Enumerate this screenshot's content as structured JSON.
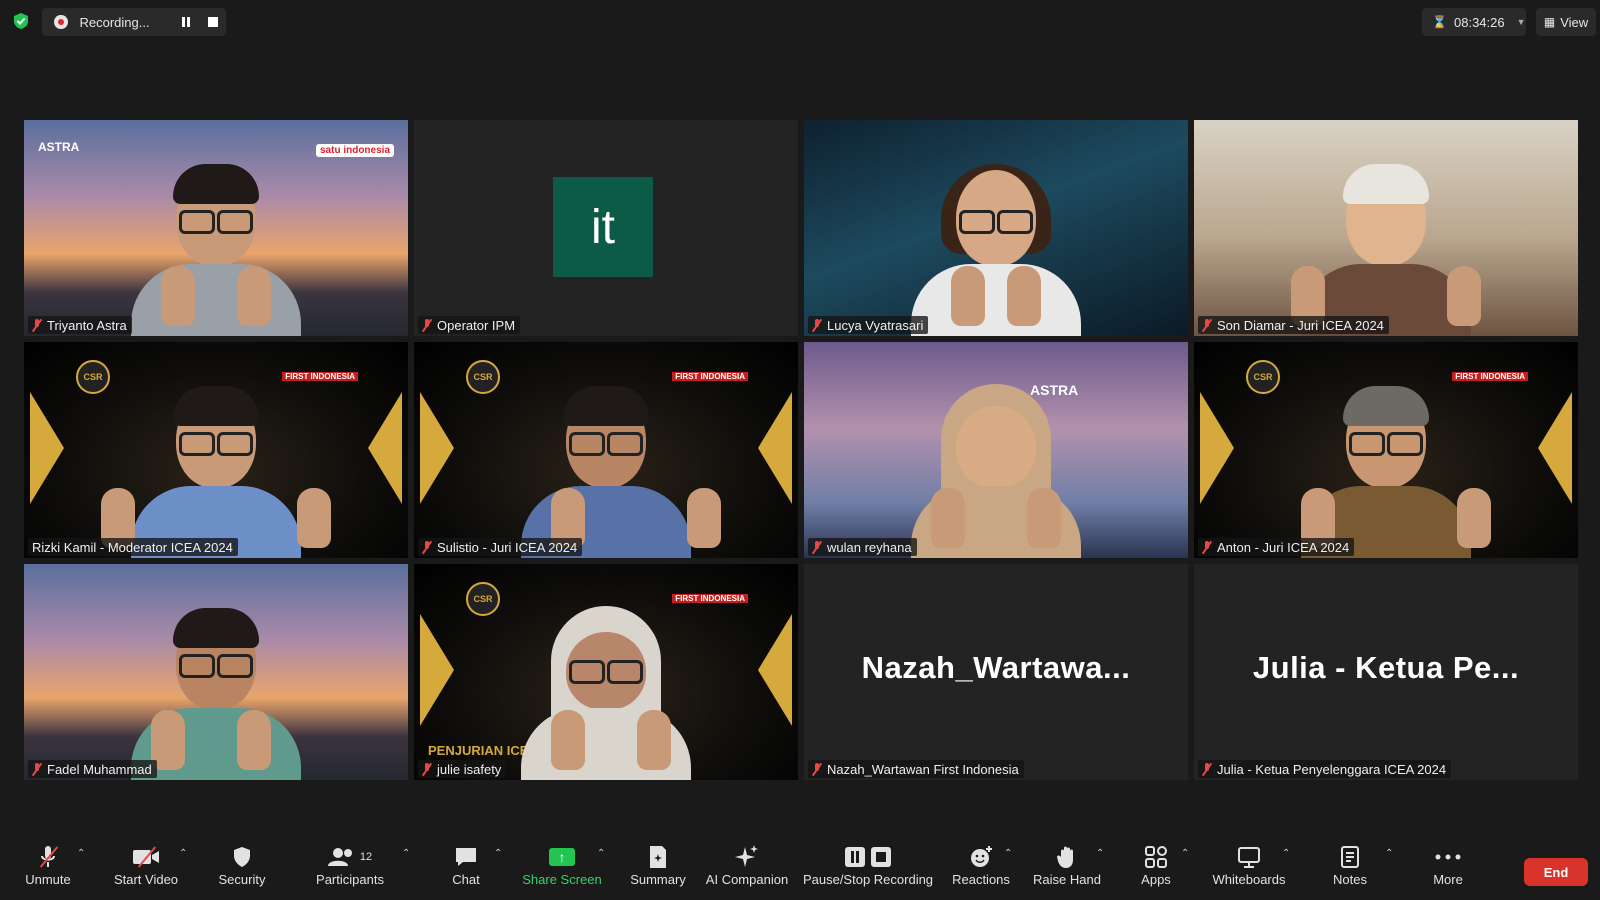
{
  "topbar": {
    "recording_label": "Recording...",
    "timer": "08:34:26",
    "view_label": "View"
  },
  "tiles": [
    {
      "name": "Triyanto Astra",
      "muted": true
    },
    {
      "name": "Operator IPM",
      "muted": true,
      "avatar_text": "it"
    },
    {
      "name": "Lucya Vyatrasari",
      "muted": true
    },
    {
      "name": "Son Diamar - Juri ICEA 2024",
      "muted": true
    },
    {
      "name": "Rizki Kamil - Moderator ICEA 2024",
      "muted": false,
      "active": true
    },
    {
      "name": "Sulistio - Juri ICEA 2024",
      "muted": true
    },
    {
      "name": "wulan reyhana",
      "muted": true
    },
    {
      "name": "Anton - Juri ICEA 2024",
      "muted": true
    },
    {
      "name": "Fadel Muhammad",
      "muted": true
    },
    {
      "name": "julie isafety",
      "muted": true
    },
    {
      "name": "Nazah_Wartawan First Indonesia",
      "muted": true,
      "display_name": "Nazah_Wartawa..."
    },
    {
      "name": "Julia - Ketua Penyelenggara ICEA 2024",
      "muted": true,
      "display_name": "Julia - Ketua Pe..."
    }
  ],
  "logos": {
    "astra": "ASTRA",
    "satu_indonesia": "satu indonesia",
    "csr": "CSR",
    "first_indonesia": "FIRST INDONESIA",
    "astra_building": "ASTRA",
    "penjurian": "PENJURIAN ICEA 202"
  },
  "toolbar": {
    "unmute": "Unmute",
    "start_video": "Start Video",
    "security": "Security",
    "participants": "Participants",
    "participants_count": "12",
    "chat": "Chat",
    "share_screen": "Share Screen",
    "summary": "Summary",
    "ai_companion": "AI Companion",
    "pause_stop_recording": "Pause/Stop Recording",
    "reactions": "Reactions",
    "raise_hand": "Raise Hand",
    "apps": "Apps",
    "whiteboards": "Whiteboards",
    "notes": "Notes",
    "more": "More",
    "end": "End"
  },
  "colors": {
    "active_speaker_border": "#e7ec7e",
    "share_green": "#23c552",
    "end_red": "#d9342b",
    "avatar_green": "#0b5b46"
  }
}
